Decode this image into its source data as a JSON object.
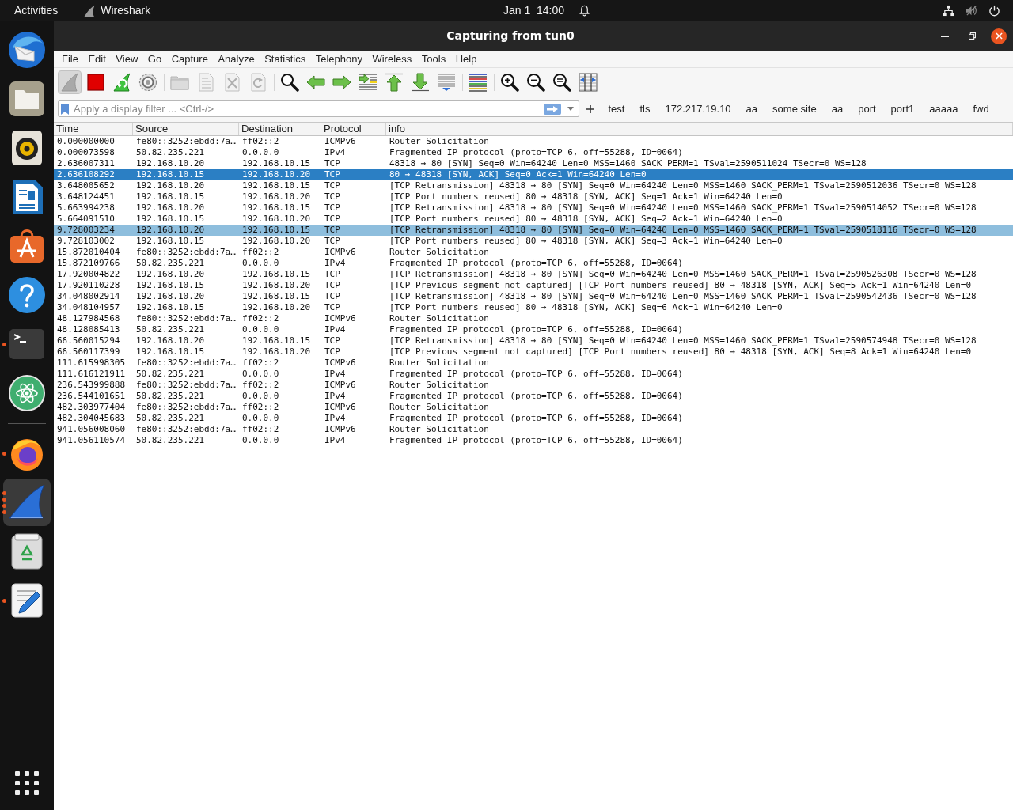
{
  "top_bar": {
    "activities": "Activities",
    "app_name": "Wireshark",
    "clock": "Jan 1  14:00"
  },
  "dock": {
    "items": [
      {
        "running": false,
        "active": false
      },
      {
        "running": false,
        "active": false
      },
      {
        "running": false,
        "active": false
      },
      {
        "running": false,
        "active": false
      },
      {
        "running": false,
        "active": false
      },
      {
        "running": false,
        "active": false
      },
      {
        "running": true,
        "several_windows": false,
        "active": false
      },
      {
        "running": false,
        "active": false
      },
      {
        "running": true,
        "several_windows": false,
        "active": false
      },
      {
        "running": true,
        "several_windows": true,
        "active": true
      },
      {
        "running": false,
        "active": false
      },
      {
        "running": true,
        "several_windows": false,
        "active": false
      }
    ]
  },
  "window": {
    "title": "Capturing from tun0"
  },
  "menu": [
    "File",
    "Edit",
    "View",
    "Go",
    "Capture",
    "Analyze",
    "Statistics",
    "Telephony",
    "Wireless",
    "Tools",
    "Help"
  ],
  "toolbar": {
    "groups": [
      [
        {
          "disabled": true,
          "pressed": true
        },
        {
          "disabled": false,
          "pressed": false
        },
        {
          "disabled": false,
          "pressed": false
        },
        {
          "disabled": false,
          "pressed": false
        }
      ],
      [
        {
          "disabled": true,
          "pressed": false
        },
        {
          "disabled": true,
          "pressed": false
        },
        {
          "disabled": true,
          "pressed": false
        },
        {
          "disabled": true,
          "pressed": false
        }
      ],
      [
        {
          "disabled": false,
          "pressed": false
        },
        {
          "disabled": false,
          "pressed": false
        },
        {
          "disabled": false,
          "pressed": false
        },
        {
          "disabled": false,
          "pressed": false
        },
        {
          "disabled": false,
          "pressed": false
        },
        {
          "disabled": false,
          "pressed": false
        },
        {
          "disabled": false,
          "pressed": false
        }
      ],
      [
        {
          "disabled": false,
          "pressed": false
        }
      ],
      [
        {
          "disabled": false,
          "pressed": false
        },
        {
          "disabled": false,
          "pressed": false
        },
        {
          "disabled": false,
          "pressed": false
        },
        {
          "disabled": false,
          "pressed": false
        }
      ]
    ]
  },
  "filter": {
    "placeholder": "Apply a display filter ... <Ctrl-/>",
    "buttons": [
      "test",
      "tls",
      "172.217.19.10",
      "aa",
      "some site",
      "aa",
      "port",
      "port1",
      "aaaaa",
      "fwd"
    ]
  },
  "packets": {
    "columns": [
      "Time",
      "Source",
      "Destination",
      "Protocol",
      "info"
    ],
    "rows": [
      {
        "cells": [
          "0.000000000",
          "fe80::3252:ebdd:7a…",
          "ff02::2",
          "ICMPv6",
          "Router Solicitation"
        ],
        "selected": false,
        "hovered": false
      },
      {
        "cells": [
          "0.000073598",
          "50.82.235.221",
          "0.0.0.0",
          "IPv4",
          "Fragmented IP protocol (proto=TCP 6, off=55288, ID=0064)"
        ],
        "selected": false,
        "hovered": false
      },
      {
        "cells": [
          "2.636007311",
          "192.168.10.20",
          "192.168.10.15",
          "TCP",
          "48318 → 80 [SYN] Seq=0 Win=64240 Len=0 MSS=1460 SACK_PERM=1 TSval=2590511024 TSecr=0 WS=128"
        ],
        "selected": false,
        "hovered": false
      },
      {
        "cells": [
          "2.636108292",
          "192.168.10.15",
          "192.168.10.20",
          "TCP",
          "80 → 48318 [SYN, ACK] Seq=0 Ack=1 Win=64240 Len=0"
        ],
        "selected": true,
        "hovered": false
      },
      {
        "cells": [
          "3.648005652",
          "192.168.10.20",
          "192.168.10.15",
          "TCP",
          "[TCP Retransmission] 48318 → 80 [SYN] Seq=0 Win=64240 Len=0 MSS=1460 SACK_PERM=1 TSval=2590512036 TSecr=0 WS=128"
        ],
        "selected": false,
        "hovered": false
      },
      {
        "cells": [
          "3.648124451",
          "192.168.10.15",
          "192.168.10.20",
          "TCP",
          "[TCP Port numbers reused] 80 → 48318 [SYN, ACK] Seq=1 Ack=1 Win=64240 Len=0"
        ],
        "selected": false,
        "hovered": false
      },
      {
        "cells": [
          "5.663994238",
          "192.168.10.20",
          "192.168.10.15",
          "TCP",
          "[TCP Retransmission] 48318 → 80 [SYN] Seq=0 Win=64240 Len=0 MSS=1460 SACK_PERM=1 TSval=2590514052 TSecr=0 WS=128"
        ],
        "selected": false,
        "hovered": false
      },
      {
        "cells": [
          "5.664091510",
          "192.168.10.15",
          "192.168.10.20",
          "TCP",
          "[TCP Port numbers reused] 80 → 48318 [SYN, ACK] Seq=2 Ack=1 Win=64240 Len=0"
        ],
        "selected": false,
        "hovered": false
      },
      {
        "cells": [
          "9.728003234",
          "192.168.10.20",
          "192.168.10.15",
          "TCP",
          "[TCP Retransmission] 48318 → 80 [SYN] Seq=0 Win=64240 Len=0 MSS=1460 SACK_PERM=1 TSval=2590518116 TSecr=0 WS=128"
        ],
        "selected": false,
        "hovered": true
      },
      {
        "cells": [
          "9.728103002",
          "192.168.10.15",
          "192.168.10.20",
          "TCP",
          "[TCP Port numbers reused] 80 → 48318 [SYN, ACK] Seq=3 Ack=1 Win=64240 Len=0"
        ],
        "selected": false,
        "hovered": false
      },
      {
        "cells": [
          "15.872010404",
          "fe80::3252:ebdd:7a…",
          "ff02::2",
          "ICMPv6",
          "Router Solicitation"
        ],
        "selected": false,
        "hovered": false
      },
      {
        "cells": [
          "15.872109766",
          "50.82.235.221",
          "0.0.0.0",
          "IPv4",
          "Fragmented IP protocol (proto=TCP 6, off=55288, ID=0064)"
        ],
        "selected": false,
        "hovered": false
      },
      {
        "cells": [
          "17.920004822",
          "192.168.10.20",
          "192.168.10.15",
          "TCP",
          "[TCP Retransmission] 48318 → 80 [SYN] Seq=0 Win=64240 Len=0 MSS=1460 SACK_PERM=1 TSval=2590526308 TSecr=0 WS=128"
        ],
        "selected": false,
        "hovered": false
      },
      {
        "cells": [
          "17.920110228",
          "192.168.10.15",
          "192.168.10.20",
          "TCP",
          "[TCP Previous segment not captured] [TCP Port numbers reused] 80 → 48318 [SYN, ACK] Seq=5 Ack=1 Win=64240 Len=0"
        ],
        "selected": false,
        "hovered": false
      },
      {
        "cells": [
          "34.048002914",
          "192.168.10.20",
          "192.168.10.15",
          "TCP",
          "[TCP Retransmission] 48318 → 80 [SYN] Seq=0 Win=64240 Len=0 MSS=1460 SACK_PERM=1 TSval=2590542436 TSecr=0 WS=128"
        ],
        "selected": false,
        "hovered": false
      },
      {
        "cells": [
          "34.048104957",
          "192.168.10.15",
          "192.168.10.20",
          "TCP",
          "[TCP Port numbers reused] 80 → 48318 [SYN, ACK] Seq=6 Ack=1 Win=64240 Len=0"
        ],
        "selected": false,
        "hovered": false
      },
      {
        "cells": [
          "48.127984568",
          "fe80::3252:ebdd:7a…",
          "ff02::2",
          "ICMPv6",
          "Router Solicitation"
        ],
        "selected": false,
        "hovered": false
      },
      {
        "cells": [
          "48.128085413",
          "50.82.235.221",
          "0.0.0.0",
          "IPv4",
          "Fragmented IP protocol (proto=TCP 6, off=55288, ID=0064)"
        ],
        "selected": false,
        "hovered": false
      },
      {
        "cells": [
          "66.560015294",
          "192.168.10.20",
          "192.168.10.15",
          "TCP",
          "[TCP Retransmission] 48318 → 80 [SYN] Seq=0 Win=64240 Len=0 MSS=1460 SACK_PERM=1 TSval=2590574948 TSecr=0 WS=128"
        ],
        "selected": false,
        "hovered": false
      },
      {
        "cells": [
          "66.560117399",
          "192.168.10.15",
          "192.168.10.20",
          "TCP",
          "[TCP Previous segment not captured] [TCP Port numbers reused] 80 → 48318 [SYN, ACK] Seq=8 Ack=1 Win=64240 Len=0"
        ],
        "selected": false,
        "hovered": false
      },
      {
        "cells": [
          "111.615998305",
          "fe80::3252:ebdd:7a…",
          "ff02::2",
          "ICMPv6",
          "Router Solicitation"
        ],
        "selected": false,
        "hovered": false
      },
      {
        "cells": [
          "111.616121911",
          "50.82.235.221",
          "0.0.0.0",
          "IPv4",
          "Fragmented IP protocol (proto=TCP 6, off=55288, ID=0064)"
        ],
        "selected": false,
        "hovered": false
      },
      {
        "cells": [
          "236.543999888",
          "fe80::3252:ebdd:7a…",
          "ff02::2",
          "ICMPv6",
          "Router Solicitation"
        ],
        "selected": false,
        "hovered": false
      },
      {
        "cells": [
          "236.544101651",
          "50.82.235.221",
          "0.0.0.0",
          "IPv4",
          "Fragmented IP protocol (proto=TCP 6, off=55288, ID=0064)"
        ],
        "selected": false,
        "hovered": false
      },
      {
        "cells": [
          "482.303977404",
          "fe80::3252:ebdd:7a…",
          "ff02::2",
          "ICMPv6",
          "Router Solicitation"
        ],
        "selected": false,
        "hovered": false
      },
      {
        "cells": [
          "482.304045683",
          "50.82.235.221",
          "0.0.0.0",
          "IPv4",
          "Fragmented IP protocol (proto=TCP 6, off=55288, ID=0064)"
        ],
        "selected": false,
        "hovered": false
      },
      {
        "cells": [
          "941.056008060",
          "fe80::3252:ebdd:7a…",
          "ff02::2",
          "ICMPv6",
          "Router Solicitation"
        ],
        "selected": false,
        "hovered": false
      },
      {
        "cells": [
          "941.056110574",
          "50.82.235.221",
          "0.0.0.0",
          "IPv4",
          "Fragmented IP protocol (proto=TCP 6, off=55288, ID=0064)"
        ],
        "selected": false,
        "hovered": false
      }
    ]
  }
}
